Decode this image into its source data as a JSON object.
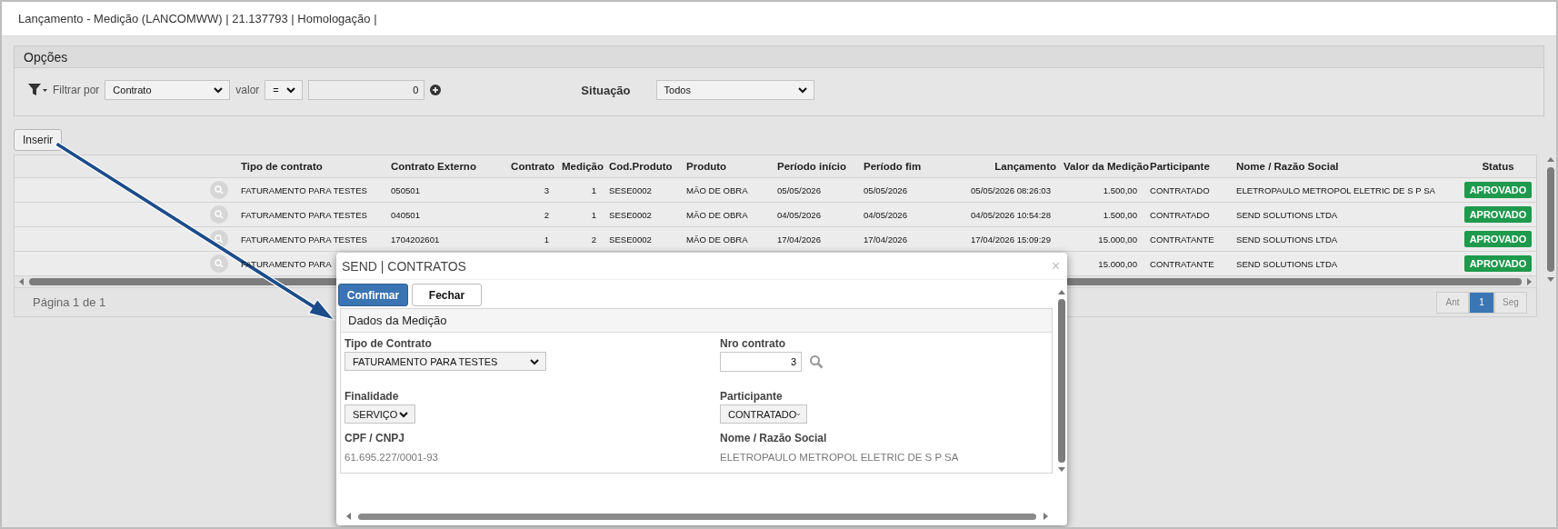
{
  "window": {
    "title": "Lançamento - Medição (LANCOMWW) | 21.137793 | Homologação |"
  },
  "options": {
    "title": "Opções",
    "filter_label": "Filtrar por",
    "filter_field": "Contrato",
    "value_label": "valor",
    "operator": "=",
    "value": "0",
    "status_label": "Situação",
    "status_value": "Todos"
  },
  "insert_button": "Inserir",
  "table": {
    "columns": [
      "Tipo de contrato",
      "Contrato Externo",
      "Contrato",
      "Medição",
      "Cod.Produto",
      "Produto",
      "Período início",
      "Período fim",
      "Lançamento",
      "Valor da Medição",
      "Participante",
      "Nome / Razão Social",
      "Status"
    ],
    "rows": [
      {
        "cells": [
          "FATURAMENTO PARA TESTES",
          "050501",
          "3",
          "1",
          "SESE0002",
          "MÃO DE OBRA",
          "05/05/2026",
          "05/05/2026",
          "05/05/2026 08:26:03",
          "1.500,00",
          "CONTRATADO",
          "ELETROPAULO METROPOL ELETRIC DE S P SA",
          "APROVADO"
        ]
      },
      {
        "cells": [
          "FATURAMENTO PARA TESTES",
          "040501",
          "2",
          "1",
          "SESE0002",
          "MÃO DE OBRA",
          "04/05/2026",
          "04/05/2026",
          "04/05/2026 10:54:28",
          "1.500,00",
          "CONTRATADO",
          "SEND SOLUTIONS LTDA",
          "APROVADO"
        ]
      },
      {
        "cells": [
          "FATURAMENTO PARA TESTES",
          "1704202601",
          "1",
          "2",
          "SESE0002",
          "MÃO DE OBRA",
          "17/04/2026",
          "17/04/2026",
          "17/04/2026 15:09:29",
          "15.000,00",
          "CONTRATANTE",
          "SEND SOLUTIONS LTDA",
          "APROVADO"
        ]
      },
      {
        "cells": [
          "FATURAMENTO PARA",
          null,
          null,
          null,
          null,
          null,
          null,
          null,
          null,
          "15.000,00",
          "CONTRATANTE",
          "SEND SOLUTIONS LTDA",
          "APROVADO"
        ]
      }
    ]
  },
  "pagination": {
    "info": "Página 1 de 1",
    "pages": [
      {
        "label": "Ant",
        "selected": false
      },
      {
        "label": "1",
        "selected": true
      },
      {
        "label": "Seg",
        "selected": false
      }
    ]
  },
  "dialog": {
    "title": "SEND | CONTRATOS",
    "close": "×",
    "buttons": [
      {
        "label": "Confirmar",
        "kind": "primary"
      },
      {
        "label": "Fechar",
        "kind": "default"
      }
    ],
    "section": "Dados da Medição",
    "fields": [
      {
        "label": "Tipo de Contrato",
        "kind": "select",
        "value": "FATURAMENTO PARA TESTES"
      },
      {
        "label": "Nro contrato",
        "kind": "lookup",
        "value": "3"
      },
      {
        "label": "Finalidade",
        "kind": "select",
        "value": "SERVIÇO"
      },
      {
        "label": "Participante",
        "kind": "select",
        "value": "CONTRATADO"
      },
      {
        "label": "CPF / CNPJ",
        "kind": "readonly",
        "value": "61.695.227/0001-93"
      },
      {
        "label": "Nome / Razão Social",
        "kind": "readonly",
        "value": "ELETROPAULO METROPOL ELETRIC DE S P SA"
      }
    ]
  }
}
